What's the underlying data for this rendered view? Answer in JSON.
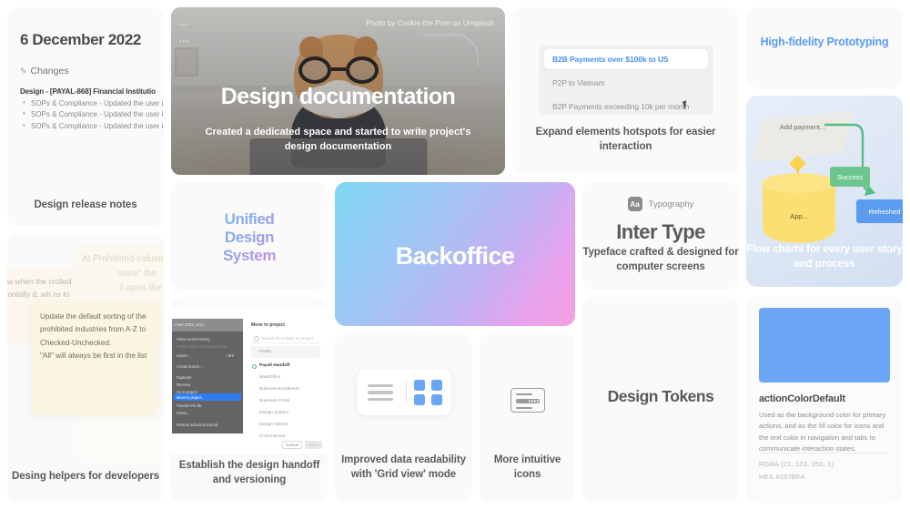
{
  "release_notes": {
    "date": "6 December 2022",
    "changes_label": "Changes",
    "pen_icon": "pencil-icon",
    "entry_title": "Design - [PAYAL-868] Financial Institutio",
    "bullets": [
      "SOPs & Compliance - Updated the user i",
      "SOPs & Compliance - Updated the user i",
      "SOPs & Compliance - Updated the user i"
    ],
    "caption": "Design release notes"
  },
  "documentation": {
    "credit": "Photo by Cookie the Pom on Unsplash",
    "title": "Design documentation",
    "subtitle": "Created a dedicated space and started to write project's design documentation"
  },
  "hotspots": {
    "rows": [
      "B2B Payments over $100k to US",
      "P2P to Vietnam",
      "B2P Payments exceeding 10k per month"
    ],
    "caption": "Expand elements hotspots for easier interaction",
    "cursor_icon": "mouse-cursor-icon"
  },
  "hifi": {
    "title": "High-fidelity Prototyping",
    "accent": "#5b9bf0"
  },
  "flow": {
    "node_parallelogram": "Add payment...",
    "node_cylinder": "App...",
    "label_success": "Success",
    "node_refreshed": "Refreshed",
    "caption": "Flow charts for every user story and process",
    "colors": {
      "success": "#6dc68e",
      "refreshed": "#5b9bf0",
      "cylinder": "#fcdf72"
    }
  },
  "uds": {
    "line1": "Unified",
    "line2": "Design",
    "line3": "System"
  },
  "backoffice": {
    "title": "Backoffice",
    "gradient_from": "#7fd8f2",
    "gradient_to": "#f59fe0"
  },
  "typography": {
    "badge_icon": "Aa",
    "badge_label": "Typography",
    "title": "Inter Type",
    "caption": "Typeface crafted & designed for computer screens"
  },
  "helpers": {
    "note_back_left": "a view when the crolled horizontally d, wh ns to",
    "note_back_right": "At Prohibited industries by clicking \"more\" the interface ll open the",
    "note_front": "Update the default sorting of the prohibited industries from A-Z to Checked-Unchecked.\n\"All\" will always be first in the list",
    "caption": "Desing helpers for developers"
  },
  "handoff": {
    "file_tab": "mber 2022_v01x",
    "menu_items": [
      {
        "label": "Show version history",
        "shortcut": "",
        "dim": false
      },
      {
        "label": "Publish styles and components",
        "shortcut": "",
        "dim": true
      },
      {
        "label": "Export...",
        "shortcut": "⇧⌘E",
        "dim": false
      },
      {
        "label": "Create branch...",
        "shortcut": "",
        "dim": false
      },
      {
        "label": "Duplicate",
        "shortcut": "",
        "dim": false
      },
      {
        "label": "Rename",
        "shortcut": "",
        "dim": false
      },
      {
        "label": "Go to project",
        "shortcut": "",
        "dim": false
      },
      {
        "label": "Move to project...",
        "shortcut": "",
        "dim": false,
        "highlighted": true
      },
      {
        "label": "Favorite this file",
        "shortcut": "",
        "dim": false
      },
      {
        "label": "Delete...",
        "shortcut": "",
        "dim": false
      },
      {
        "label": "Restore default thumbnail",
        "shortcut": "",
        "dim": false
      }
    ],
    "panel_title": "Move to project",
    "search_placeholder": "Search for a team or project",
    "drafts_label": "Drafts",
    "projects": [
      "Payall Handoff",
      "BackOffice",
      "Business Enrollment",
      "Business Portal",
      "Design System",
      "Design Tokens",
      "FI Enrollment"
    ],
    "cancel_label": "Cancel",
    "move_label": "Move",
    "caption": "Establish the design handoff and versioning"
  },
  "gridview": {
    "list_icon": "list-view-icon",
    "grid_icon": "grid-view-icon",
    "caption": "Improved data readability with 'Grid view' mode"
  },
  "icons": {
    "card_icon": "payment-card-icon",
    "caption": "More intuitive icons"
  },
  "tokens": {
    "title": "Design Tokens"
  },
  "color_token": {
    "swatch": "#6aa6f5",
    "name": "actionColorDefault",
    "description": "Used as the background color for primary actions, and as the fill color for icons and the text color in navigation and tabs to communicate interaction states.",
    "rgba": "RGBA (21, 123, 250, 1)",
    "hex": "HEX #157BFA"
  }
}
